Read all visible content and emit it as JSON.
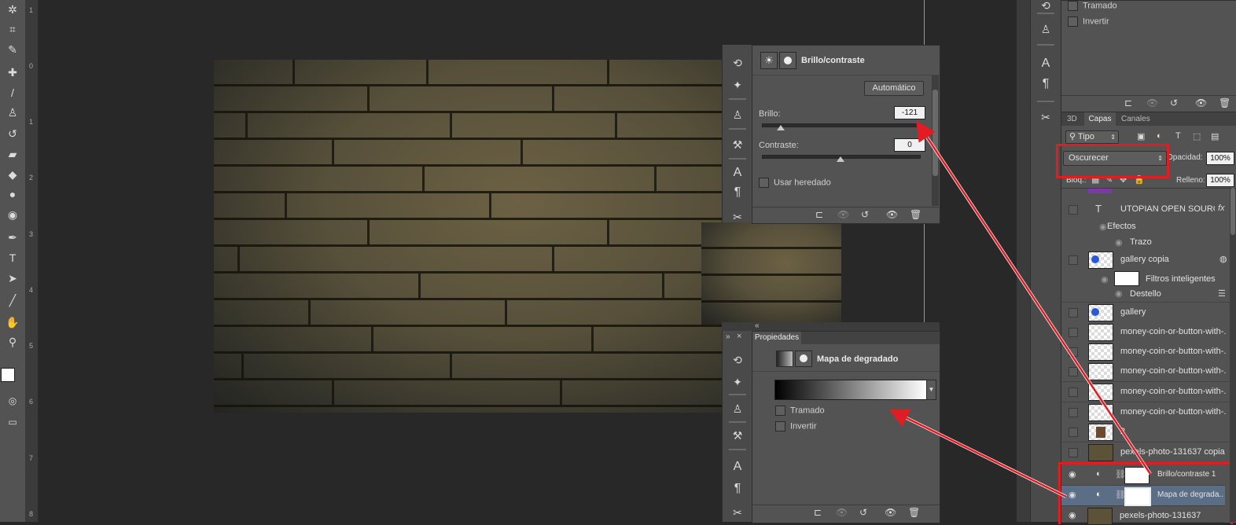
{
  "tools": {
    "icons": [
      "magic-wand-icon",
      "crop-icon",
      "eyedropper-icon",
      "healing-brush-icon",
      "brush-icon",
      "clone-stamp-icon",
      "history-brush-icon",
      "eraser-icon",
      "paint-bucket-icon",
      "blur-icon",
      "dodge-icon",
      "pen-icon",
      "type-icon",
      "path-select-icon",
      "line-icon",
      "hand-icon",
      "zoom-icon"
    ],
    "type_glyph": "T"
  },
  "ruler": {
    "marks": [
      "1",
      "0",
      "1",
      "2",
      "3",
      "4",
      "5",
      "6",
      "7",
      "8"
    ]
  },
  "brightness_panel": {
    "title": "Brillo/contraste",
    "auto_button": "Automático",
    "brillo_label": "Brillo:",
    "brillo_value": "-121",
    "brillo_fraction": 0.12,
    "contraste_label": "Contraste:",
    "contraste_value": "0",
    "contraste_fraction": 0.5,
    "legacy_label": "Usar heredado",
    "dock_glyph_a": "A",
    "dock_glyph_p": "¶"
  },
  "properties_panel": {
    "tab_label": "Propiedades",
    "collapse_glyph": "«",
    "expand_glyph": "»",
    "close_glyph": "×",
    "title": "Mapa de degradado",
    "tramado_label": "Tramado",
    "invertir_label": "Invertir",
    "dock_glyph_a": "A",
    "dock_glyph_p": "¶"
  },
  "top_right_panel": {
    "tramado_label": "Tramado",
    "invertir_label": "Invertir",
    "dock_glyph_a": "A",
    "dock_glyph_p": "¶"
  },
  "layers_panel": {
    "tabs": [
      "3D",
      "Capas",
      "Canales"
    ],
    "filter_label": "Tipo",
    "blend_mode": "Oscurecer",
    "opacity_label": "Opacidad:",
    "opacity_value": "100%",
    "lock_label": "Bloq.:",
    "fill_label": "Relleno:",
    "fill_value": "100%",
    "type_layer_glyph": "T",
    "fx_label": "fx",
    "layers": [
      {
        "name": "UTOPIAN OPEN SOURCE..."
      },
      {
        "name": "Efectos"
      },
      {
        "name": "Trazo"
      },
      {
        "name": "gallery copia"
      },
      {
        "name": "Filtros inteligentes"
      },
      {
        "name": "Destello"
      },
      {
        "name": "gallery"
      },
      {
        "name": "money-coin-or-button-with-..."
      },
      {
        "name": "money-coin-or-button-with-..."
      },
      {
        "name": "money-coin-or-button-with-..."
      },
      {
        "name": "money-coin-or-button-with-..."
      },
      {
        "name": "money-coin-or-button-with-..."
      },
      {
        "name": "2"
      },
      {
        "name": "pexels-photo-131637 copia"
      },
      {
        "name": "Brillo/contraste 1"
      },
      {
        "name": "Mapa de degrada..."
      },
      {
        "name": "pexels-photo-131637"
      }
    ]
  },
  "colors": {
    "annotation_red": "#e31b23",
    "guide_cyan": "#2ec4c4"
  }
}
